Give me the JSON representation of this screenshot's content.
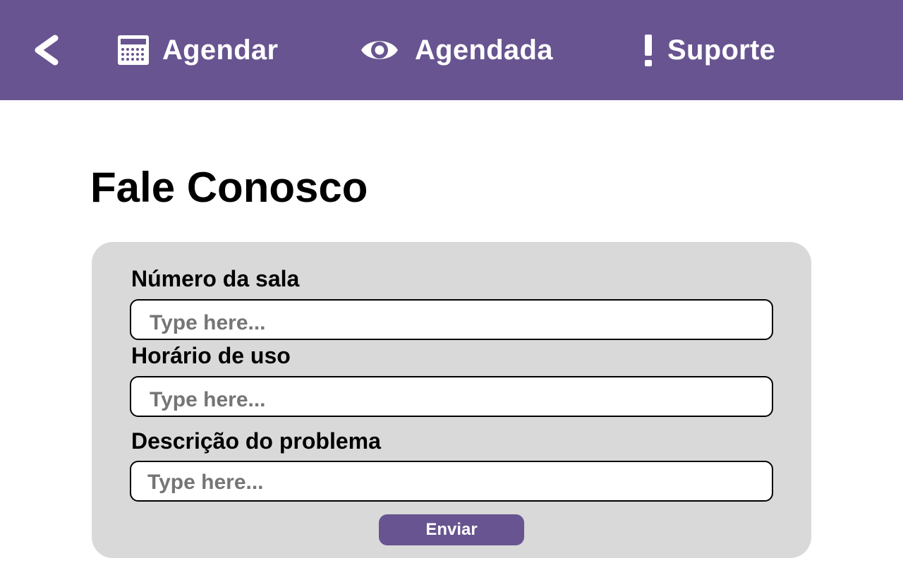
{
  "nav": {
    "back_icon": "chevron-left-icon",
    "items": [
      {
        "label": "Agendar",
        "icon": "calendar-icon"
      },
      {
        "label": "Agendada",
        "icon": "eye-icon"
      },
      {
        "label": "Suporte",
        "icon": "exclamation-icon"
      }
    ]
  },
  "page": {
    "title": "Fale Conosco"
  },
  "form": {
    "fields": [
      {
        "label": "Número da sala",
        "placeholder": "Type here...",
        "value": ""
      },
      {
        "label": "Horário de uso",
        "placeholder": "Type here...",
        "value": ""
      },
      {
        "label": "Descrição do problema",
        "placeholder": "Type here...",
        "value": ""
      }
    ],
    "submit_label": "Enviar"
  },
  "colors": {
    "primary": "#675490",
    "card_background": "#d9d9d9",
    "text": "#000000",
    "placeholder": "#757575"
  }
}
